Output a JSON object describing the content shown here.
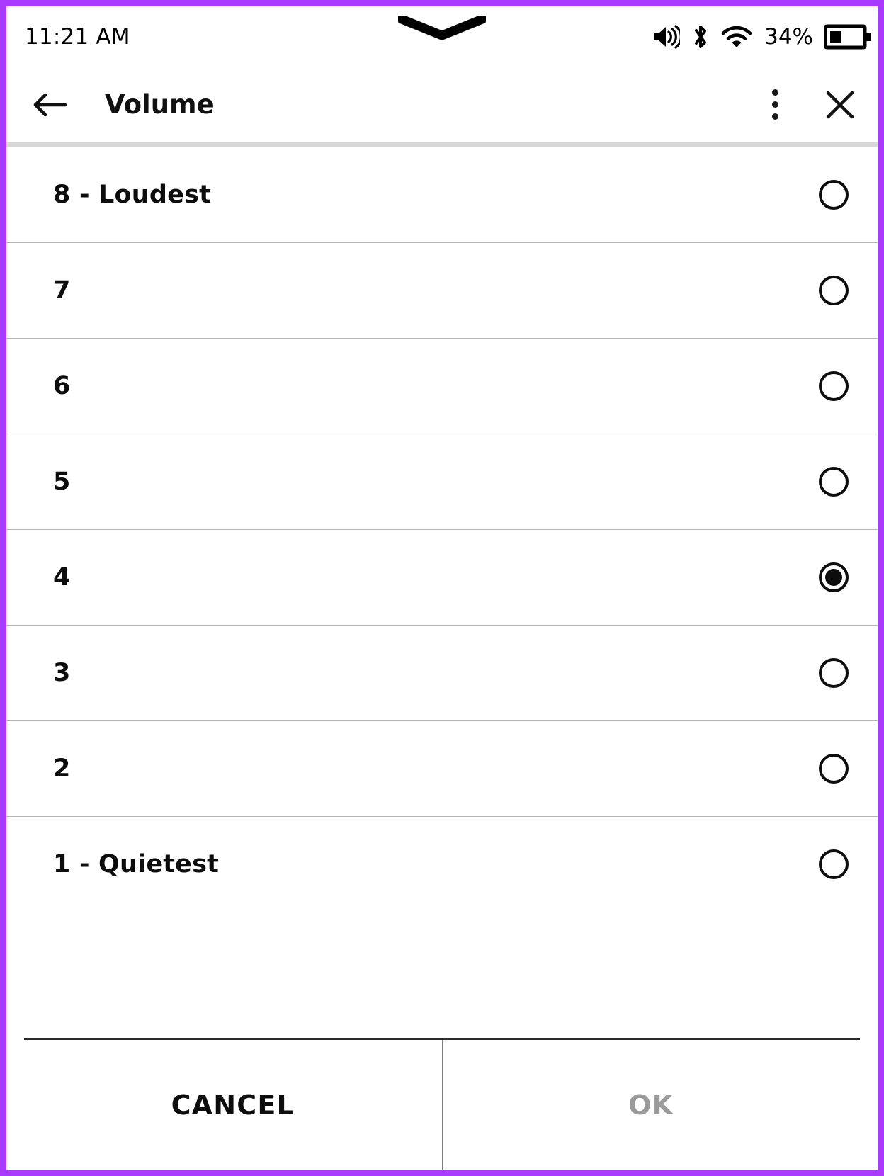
{
  "frame": {
    "border_color": "#a93aff"
  },
  "status_bar": {
    "clock": "11:21 AM",
    "battery_percent": "34%",
    "icons": [
      {
        "name": "volume-icon",
        "label": "volume"
      },
      {
        "name": "bluetooth-icon",
        "label": "bluetooth"
      },
      {
        "name": "wifi-icon",
        "label": "wifi"
      },
      {
        "name": "battery-icon",
        "label": "battery"
      }
    ],
    "notch": "notch-chevron-icon"
  },
  "toolbar": {
    "back_icon": "back-arrow-icon",
    "title": "Volume",
    "overflow_icon": "overflow-menu-icon",
    "close_icon": "close-icon"
  },
  "list": {
    "selected_value": "4",
    "items": [
      {
        "value": "8",
        "label": "8 - Loudest",
        "selected": false
      },
      {
        "value": "7",
        "label": "7",
        "selected": false
      },
      {
        "value": "6",
        "label": "6",
        "selected": false
      },
      {
        "value": "5",
        "label": "5",
        "selected": false
      },
      {
        "value": "4",
        "label": "4",
        "selected": true
      },
      {
        "value": "3",
        "label": "3",
        "selected": false
      },
      {
        "value": "2",
        "label": "2",
        "selected": false
      },
      {
        "value": "1",
        "label": "1 - Quietest",
        "selected": false
      }
    ]
  },
  "footer": {
    "cancel_label": "CANCEL",
    "ok_label": "OK",
    "ok_enabled": false
  }
}
